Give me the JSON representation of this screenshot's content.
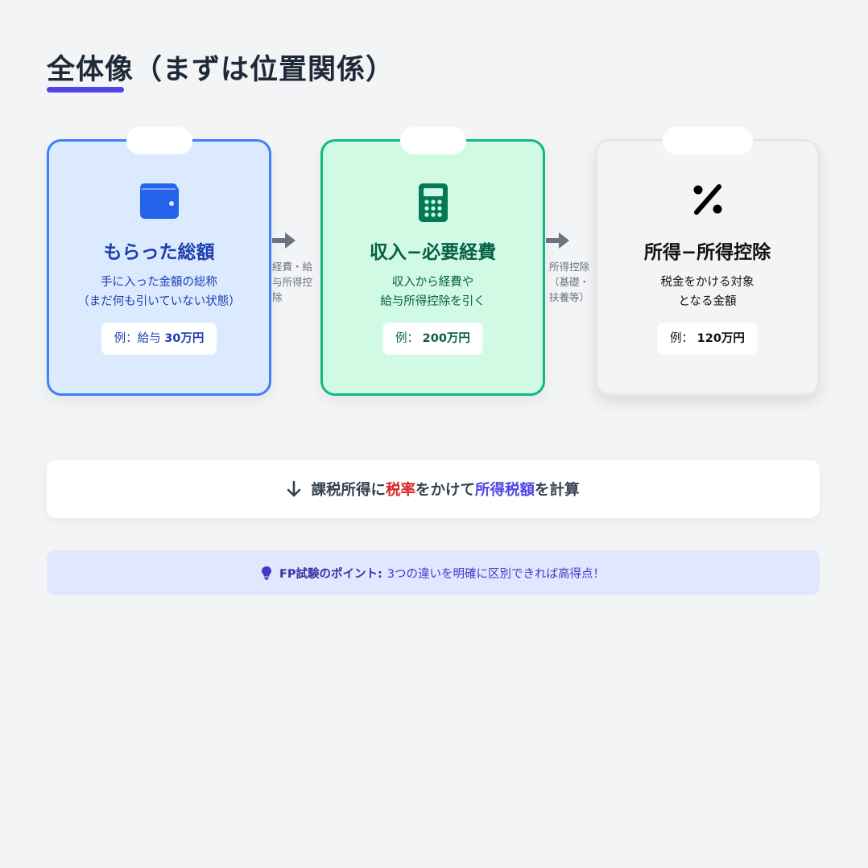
{
  "page": {
    "title": "全体像（まずは位置関係）",
    "accent_color": "#4f46e5"
  },
  "cards": [
    {
      "icon": "wallet-icon",
      "title": "もらった総額",
      "desc_line1": "手に入った金額の総称",
      "desc_line2": "（まだ何も引いていない状態）",
      "example_prefix": "例：給与",
      "example_value": "30万円",
      "color": "#3b82f6"
    },
    {
      "icon": "calculator-icon",
      "title": "収入−必要経費",
      "desc_line1": "収入から経費や",
      "desc_line2": "給与所得控除を引く",
      "example_prefix": "例：",
      "example_value": "200万円",
      "color": "#10b981"
    },
    {
      "icon": "percent-icon",
      "title": "所得−所得控除",
      "desc_line1": "税金をかける対象",
      "desc_line2": "となる金額",
      "example_prefix": "例：",
      "example_value": "120万円",
      "color": "#111111"
    }
  ],
  "connectors": [
    {
      "line1": "経費・給",
      "line2": "与所得控",
      "line3": "除"
    },
    {
      "line1": "所得控除",
      "line2": "（基礎・",
      "line3": "扶養等）"
    }
  ],
  "calc": {
    "icon": "arrow-down-icon",
    "part1": "課税所得に",
    "part2": "税率",
    "part3": "をかけて",
    "part4": "所得税額",
    "part5": "を計算"
  },
  "tip": {
    "icon": "lightbulb-icon",
    "label": "FP試験のポイント:",
    "text": "3つの違いを明確に区別できれば高得点！"
  }
}
